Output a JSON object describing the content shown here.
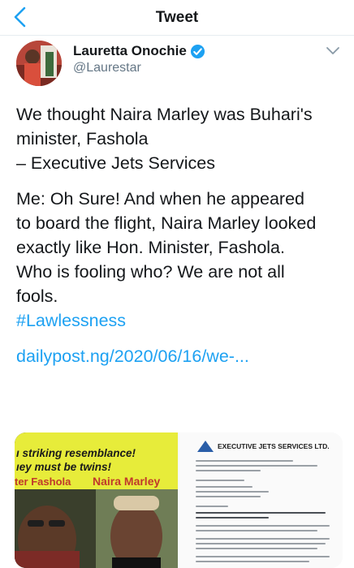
{
  "navbar": {
    "title": "Tweet",
    "back_icon": "chevron-left-icon",
    "accent": "#1da1f2"
  },
  "author": {
    "name": "Lauretta Onochie",
    "handle": "@Laurestar",
    "verified_icon": "verified-badge-icon",
    "menu_icon": "chevron-down-icon"
  },
  "tweet": {
    "line1": "We thought Naira Marley was Buhari's",
    "line2": "minister, Fashola",
    "line3": "– Executive Jets Services",
    "line4": "Me: Oh Sure! And when he appeared",
    "line5": "to board the flight, Naira Marley looked",
    "line6": "exactly like Hon. Minister, Fashola.",
    "line7": "Who is fooling who? We are not all",
    "line8": "fools.",
    "hashtag": "#Lawlessness",
    "link": "dailypost.ng/2020/06/16/we-..."
  },
  "media": {
    "left": {
      "line1": "ı striking resemblance!",
      "line2": "ıey must be twins!",
      "name1": "ter Fashola",
      "name2": "Naira Marley"
    },
    "right": {
      "doc_title": "EXECUTIVE JETS SERVICES LTD."
    }
  }
}
